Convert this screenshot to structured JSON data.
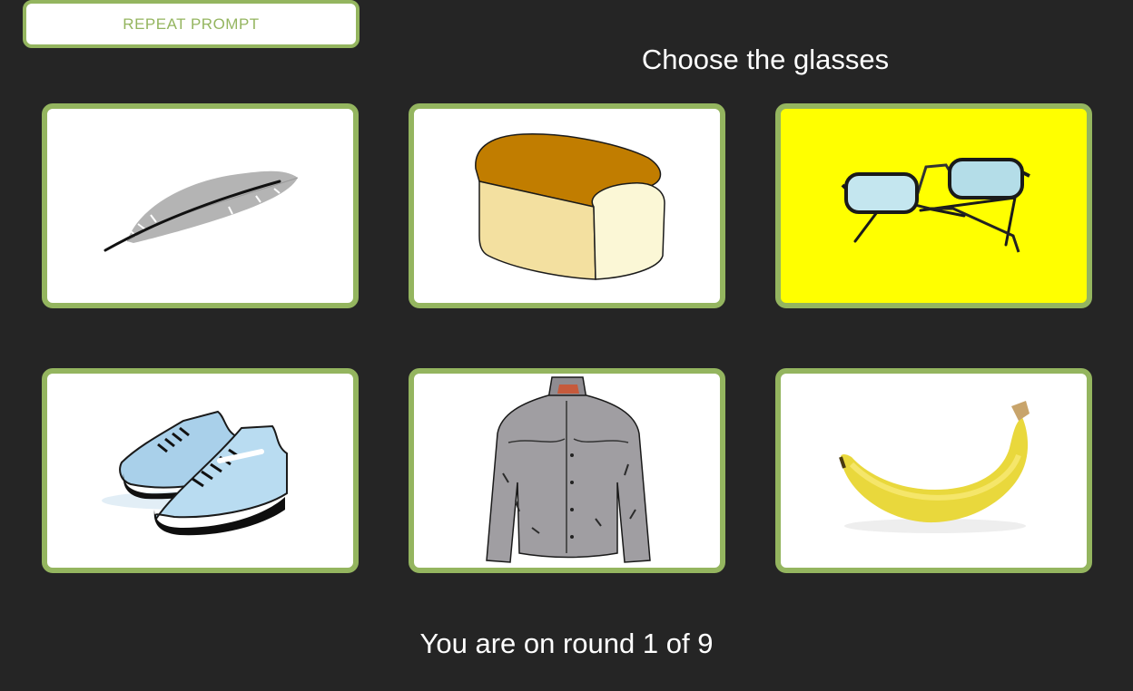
{
  "header": {
    "repeat_label": "REPEAT PROMPT",
    "prompt_text": "Choose the glasses"
  },
  "cards": [
    {
      "icon": "feather-icon",
      "background": "#ffffff",
      "selected": false
    },
    {
      "icon": "bread-icon",
      "background": "#ffffff",
      "selected": false
    },
    {
      "icon": "glasses-icon",
      "background": "#ffff00",
      "selected": true
    },
    {
      "icon": "sneakers-icon",
      "background": "#ffffff",
      "selected": false
    },
    {
      "icon": "jacket-icon",
      "background": "#ffffff",
      "selected": false
    },
    {
      "icon": "banana-icon",
      "background": "#ffffff",
      "selected": false
    }
  ],
  "footer": {
    "round_text": "You are on round 1 of 9"
  },
  "colors": {
    "background": "#252525",
    "accent": "#94b55f",
    "highlight": "#ffff00"
  }
}
